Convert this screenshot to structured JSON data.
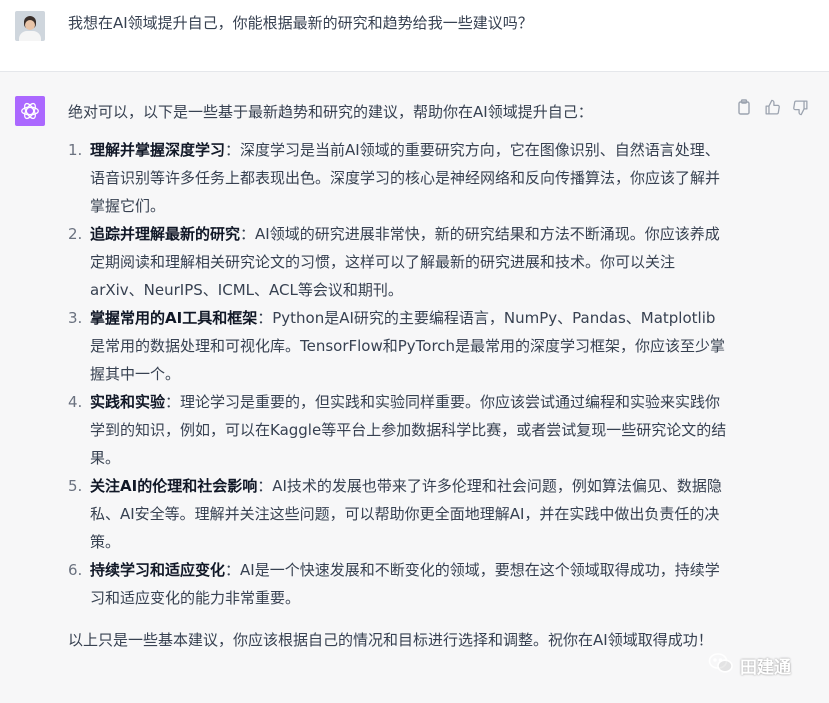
{
  "user": {
    "message": "我想在AI领域提升自己，你能根据最新的研究和趋势给我一些建议吗？"
  },
  "assistant": {
    "intro": "绝对可以，以下是一些基于最新趋势和研究的建议，帮助你在AI领域提升自己：",
    "tips": [
      {
        "num": "1.",
        "title": "理解并掌握深度学习",
        "sep": "：",
        "body": "深度学习是当前AI领域的重要研究方向，它在图像识别、自然语言处理、语音识别等许多任务上都表现出色。深度学习的核心是神经网络和反向传播算法，你应该了解并掌握它们。"
      },
      {
        "num": "2.",
        "title": "追踪并理解最新的研究",
        "sep": "：",
        "body": "AI领域的研究进展非常快，新的研究结果和方法不断涌现。你应该养成定期阅读和理解相关研究论文的习惯，这样可以了解最新的研究进展和技术。你可以关注arXiv、NeurIPS、ICML、ACL等会议和期刊。"
      },
      {
        "num": "3.",
        "title": "掌握常用的AI工具和框架",
        "sep": "：",
        "body": "Python是AI研究的主要编程语言，NumPy、Pandas、Matplotlib是常用的数据处理和可视化库。TensorFlow和PyTorch是最常用的深度学习框架，你应该至少掌握其中一个。"
      },
      {
        "num": "4.",
        "title": "实践和实验",
        "sep": "：",
        "body": "理论学习是重要的，但实践和实验同样重要。你应该尝试通过编程和实验来实践你学到的知识，例如，可以在Kaggle等平台上参加数据科学比赛，或者尝试复现一些研究论文的结果。"
      },
      {
        "num": "5.",
        "title": "关注AI的伦理和社会影响",
        "sep": "：",
        "body": "AI技术的发展也带来了许多伦理和社会问题，例如算法偏见、数据隐私、AI安全等。理解并关注这些问题，可以帮助你更全面地理解AI，并在实践中做出负责任的决策。"
      },
      {
        "num": "6.",
        "title": "持续学习和适应变化",
        "sep": "：",
        "body": "AI是一个快速发展和不断变化的领域，要想在这个领域取得成功，持续学习和适应变化的能力非常重要。"
      }
    ],
    "outro": "以上只是一些基本建议，你应该根据自己的情况和目标进行选择和调整。祝你在AI领域取得成功！"
  },
  "actions": [
    "copy-icon",
    "thumbs-up-icon",
    "thumbs-down-icon"
  ],
  "watermark": {
    "text": "田建通"
  },
  "colors": {
    "logo_bg": "#ab68ff",
    "assistant_bg": "#f7f7f8"
  }
}
